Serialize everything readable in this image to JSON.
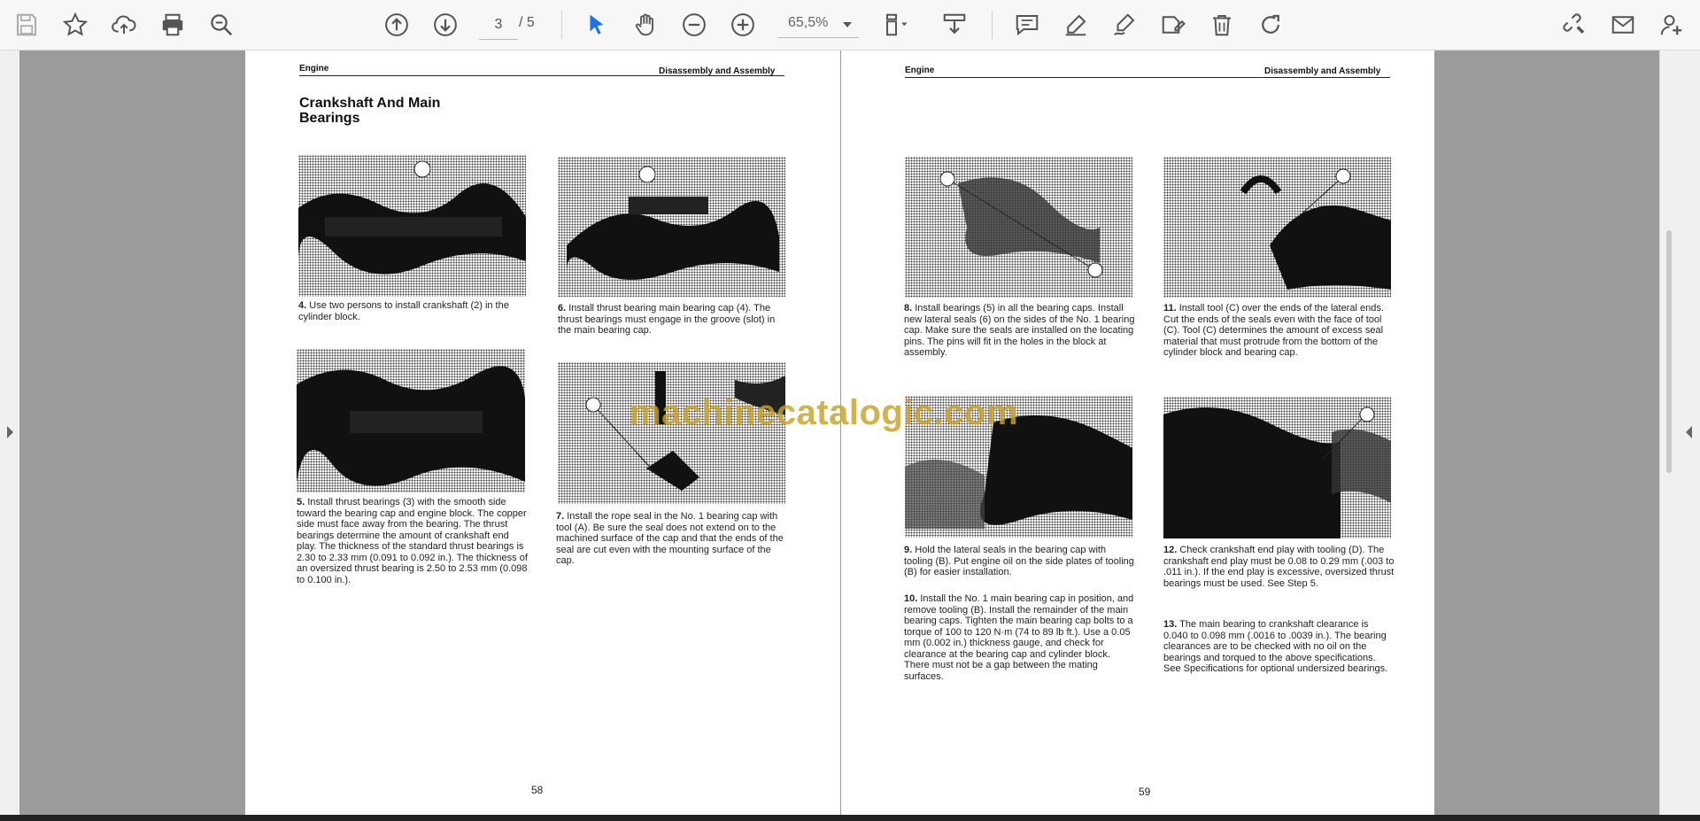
{
  "toolbar": {
    "current_page": "3",
    "total_pages": "/ 5",
    "zoom": "65,5%"
  },
  "watermark": "machinecatalogic.com",
  "pages": [
    {
      "header_left": "Engine",
      "header_right": "Disassembly and Assembly",
      "section_title_1": "Crankshaft And Main",
      "section_title_2": "Bearings",
      "captions": [
        {
          "num": "4.",
          "text": "Use two persons to install crankshaft (2) in the cylinder block."
        },
        {
          "num": "6.",
          "text": "Install thrust bearing main bearing cap (4). The thrust bearings must engage in the groove (slot) in the main bearing cap."
        },
        {
          "num": "5.",
          "text": "Install thrust bearings (3) with the smooth side toward the bearing cap and engine block. The copper side must face away from the bearing. The thrust bearings determine the amount of crankshaft end play. The thickness of the standard thrust bearings is 2.30 to 2.33 mm (0.091 to 0.092 in.). The thickness of an oversized thrust bearing is 2.50 to 2.53 mm (0.098 to 0.100 in.)."
        },
        {
          "num": "7.",
          "text": "Install the rope seal in the No. 1 bearing cap with tool (A). Be sure the seal does not extend on to the machined surface of the cap and that the ends of the seal are cut even with the mounting surface of the cap."
        }
      ],
      "page_number": "58"
    },
    {
      "header_left": "Engine",
      "header_right": "Disassembly and Assembly",
      "captions": [
        {
          "num": "8.",
          "text": "Install bearings (5) in all the bearing caps. Install new lateral seals (6) on the sides of the No. 1 bearing cap. Make sure the seals are installed on the locating pins. The pins will fit in the holes in the block at assembly."
        },
        {
          "num": "11.",
          "text": "Install tool (C) over the ends of the lateral ends. Cut the ends of the seals even with the face of tool (C). Tool (C) determines the amount of excess seal material that must protrude from the bottom of the cylinder block and bearing cap."
        },
        {
          "num": "9.",
          "text": "Hold the lateral seals in the bearing cap with tooling (B). Put engine oil on the side plates of tooling (B) for easier installation."
        },
        {
          "num": "10.",
          "text": "Install the No. 1 main bearing cap in position, and remove tooling (B). Install the remainder of the main bearing caps. Tighten the main bearing cap bolts to a torque of 100 to 120 N·m (74 to 89 lb ft.). Use a 0.05 mm (0.002 in.) thickness gauge, and check for clearance at the bearing cap and cylinder block. There must not be a gap between the mating surfaces."
        },
        {
          "num": "12.",
          "text": "Check crankshaft end play with tooling (D). The crankshaft end play must be 0.08 to 0.29 mm (.003 to .011 in.). If the end play is excessive, oversized thrust bearings must be used. See Step 5."
        },
        {
          "num": "13.",
          "text": "The main bearing to crankshaft clearance is 0.040 to 0.098 mm (.0016 to .0039 in.). The bearing clearances are to be checked with no oil on the bearings and torqued to the above specifications. See Specifications for optional undersized bearings."
        }
      ],
      "page_number": "59"
    }
  ]
}
